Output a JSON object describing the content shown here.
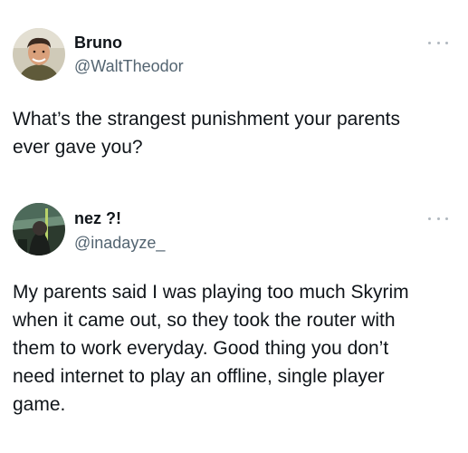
{
  "tweets": [
    {
      "author": {
        "name": "Bruno",
        "handle": "@WaltTheodor",
        "avatar": "profile-photo-man-smiling"
      },
      "more_icon": "more-options-icon",
      "text": "What’s the strangest punishment your parents\never gave you?"
    },
    {
      "author": {
        "name": "nez ?!",
        "handle": "@inadayze_",
        "avatar": "profile-photo-game-scene"
      },
      "more_icon": "more-options-icon",
      "text": "My parents said I was playing too much Skyrim\nwhen it came out, so they took the router with\nthem to work everyday. Good thing you don’t\nneed internet to play an offline, single player\ngame."
    }
  ],
  "colors": {
    "text": "#0f1419",
    "secondary": "#536471",
    "background": "#ffffff"
  }
}
